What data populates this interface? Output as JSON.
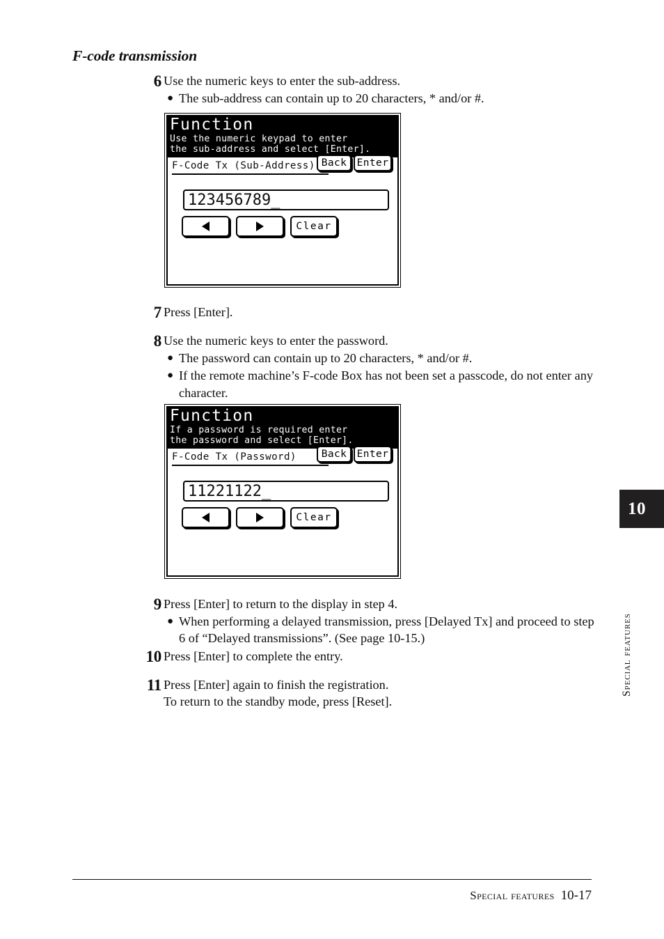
{
  "heading": "F-code transmission",
  "steps": [
    {
      "number": "6",
      "lead": "Use the numeric keys to enter the sub-address.",
      "bullets": [
        "The sub-address can contain up to 20 characters, * and/or #."
      ]
    },
    {
      "number": "7",
      "lead": "Press [Enter].",
      "bullets": []
    },
    {
      "number": "8",
      "lead": "Use the numeric keys to enter the password.",
      "bullets": [
        "The password can contain up to 20 characters, * and/or #.",
        "If the remote machine’s F-code Box has not been set a passcode, do not enter any character."
      ]
    },
    {
      "number": "9",
      "lead": "Press [Enter] to return to the display in step 4.",
      "bullets": [
        "When performing a delayed transmission, press [Delayed Tx] and proceed to step 6 of “Delayed transmissions”. (See page 10-15.)"
      ]
    },
    {
      "number": "10",
      "lead": "Press [Enter] to complete the entry.",
      "bullets": []
    },
    {
      "number": "11",
      "lead": "Press [Enter] again to finish the registration.",
      "cont": "To return to the standby mode, press [Reset].",
      "bullets": []
    }
  ],
  "panels": [
    {
      "title": "Function",
      "sub_line1": "Use the numeric keypad to enter",
      "sub_line2": "the sub-address and select [Enter].",
      "field_name": "F-Code Tx (Sub-Address)",
      "back_label": "Back",
      "enter_label": "Enter",
      "input_value": "123456789_",
      "key_left": "◀",
      "key_right": "▶",
      "clear_label": "Clear"
    },
    {
      "title": "Function",
      "sub_line1": "If a password is required enter",
      "sub_line2": "the password and select [Enter].",
      "field_name": "F-Code Tx (Password)",
      "back_label": "Back",
      "enter_label": "Enter",
      "input_value": "11221122_",
      "key_left": "◀",
      "key_right": "▶",
      "clear_label": "Clear"
    }
  ],
  "side_tab": {
    "chapter_number": "10",
    "chapter_name": "Special features"
  },
  "footer": {
    "label": "Special features",
    "page": "10-17"
  },
  "colors": {
    "ink": "#0d0d0d",
    "tab_background": "#211f1f",
    "lcd_header": "#000000",
    "page_background": "#ffffff"
  }
}
